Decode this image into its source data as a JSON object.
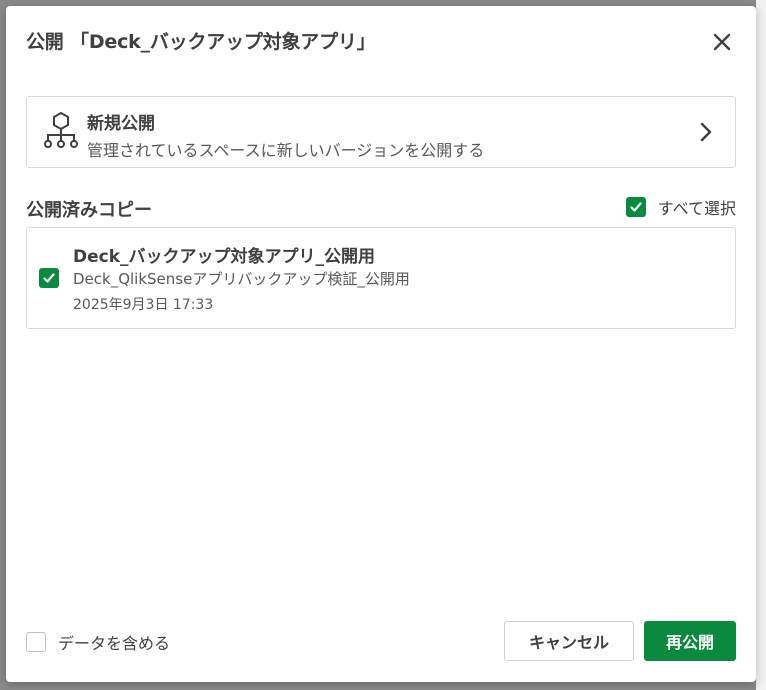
{
  "dialog": {
    "title": "公開 「Deck_バックアップ対象アプリ」"
  },
  "new_publish": {
    "title": "新規公開",
    "description": "管理されているスペースに新しいバージョンを公開する"
  },
  "published_copies": {
    "section_title": "公開済みコピー",
    "select_all_label": "すべて選択",
    "select_all_checked": true,
    "items": [
      {
        "name": "Deck_バックアップ対象アプリ_公開用",
        "space": "Deck_QlikSenseアプリバックアップ検証_公開用",
        "date": "2025年9月3日 17:33",
        "checked": true
      }
    ]
  },
  "footer": {
    "include_data_label": "データを含める",
    "include_data_checked": false,
    "cancel_label": "キャンセル",
    "republish_label": "再公開"
  },
  "colors": {
    "accent": "#0a8a3f",
    "text": "#404040",
    "border": "#d9d9d9"
  },
  "icons": {
    "close": "close-icon",
    "publish": "hierarchy-icon",
    "chevron": "chevron-right-icon",
    "check": "check-icon"
  }
}
